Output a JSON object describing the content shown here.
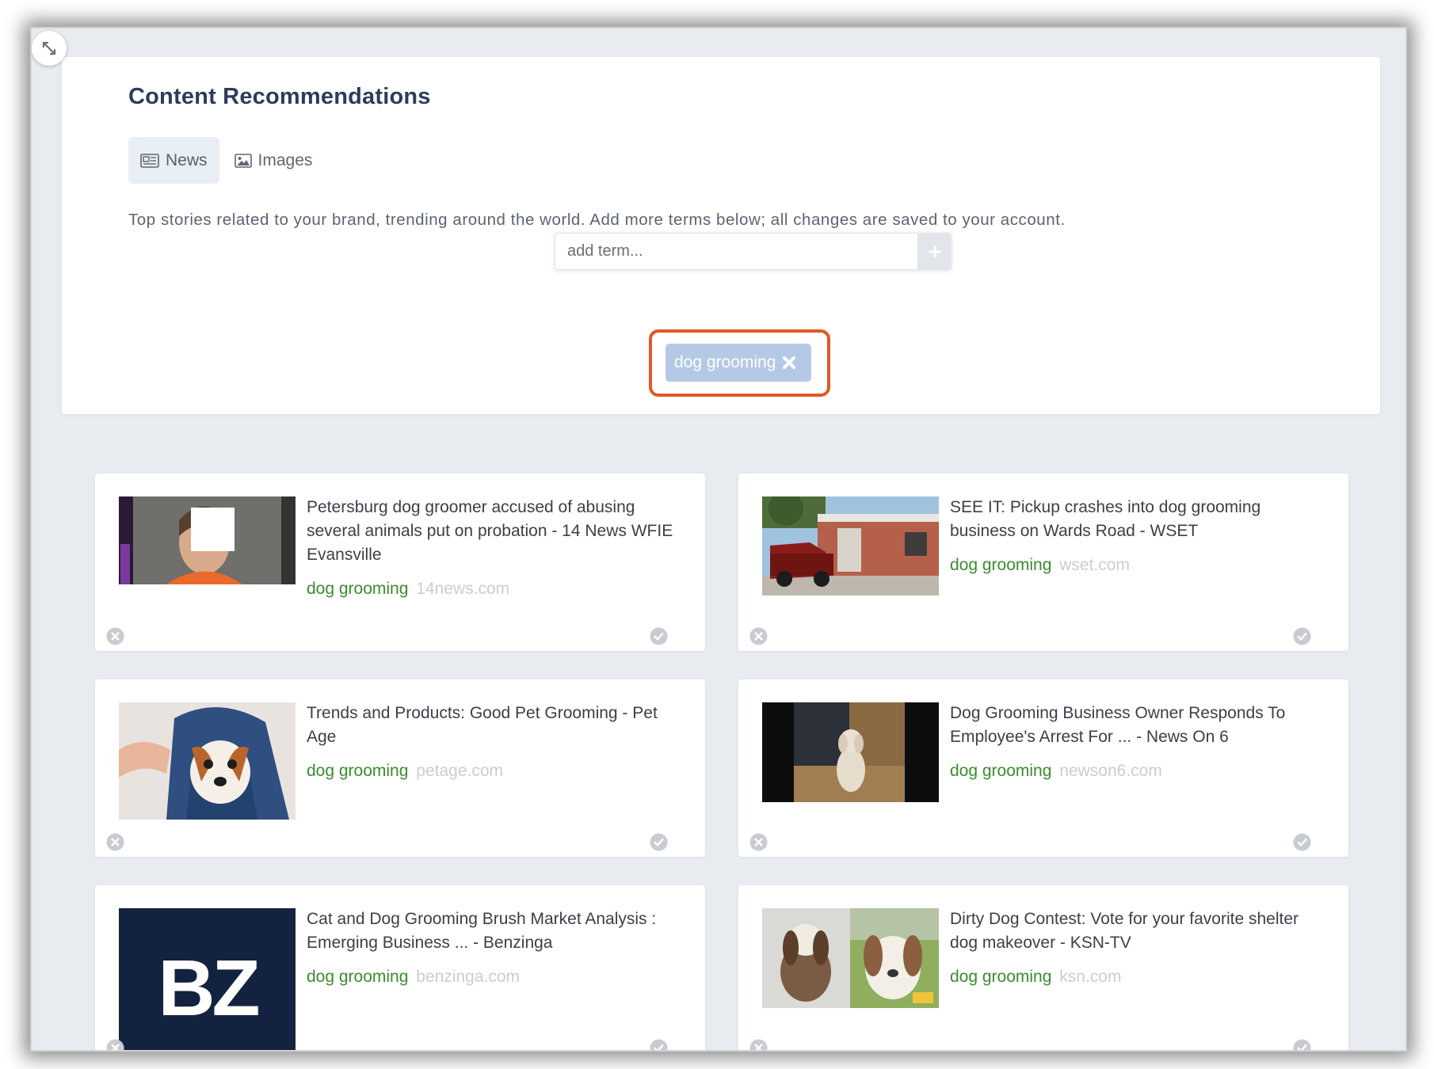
{
  "window": {
    "expand_icon": "expand-diagonal-icon"
  },
  "header": {
    "title": "Content Recommendations"
  },
  "tabs": [
    {
      "label": "News",
      "icon": "newspaper-icon",
      "active": true
    },
    {
      "label": "Images",
      "icon": "image-icon",
      "active": false
    }
  ],
  "description": "Top stories related to your brand, trending around the world. Add more terms below; all changes are saved to your account.",
  "term_input": {
    "placeholder": "add term...",
    "value": "",
    "add_icon": "plus-icon"
  },
  "terms": [
    {
      "label": "dog grooming",
      "remove_icon": "close-x-icon"
    }
  ],
  "colors": {
    "title": "#2b3d5b",
    "term_green": "#3a8c2e",
    "source_gray": "#c9cdd2",
    "chip_bg": "#b5c9e7",
    "highlight": "#dc5a27",
    "page_bg": "#e8ebef"
  },
  "cards": [
    {
      "title": "Petersburg dog groomer accused of abusing several animals put on probation - 14 News WFIE Evansville",
      "term": "dog grooming",
      "source": "14news.com"
    },
    {
      "title": "SEE IT: Pickup crashes into dog grooming business on Wards Road - WSET",
      "term": "dog grooming",
      "source": "wset.com"
    },
    {
      "title": "Trends and Products: Good Pet Grooming - Pet Age",
      "term": "dog grooming",
      "source": "petage.com"
    },
    {
      "title": "Dog Grooming Business Owner Responds To Employee's Arrest For ... - News On 6",
      "term": "dog grooming",
      "source": "newson6.com"
    },
    {
      "title": "Cat and Dog Grooming Brush Market Analysis : Emerging Business ... - Benzinga",
      "term": "dog grooming",
      "source": "benzinga.com",
      "logo_text": "BZ"
    },
    {
      "title": "Dirty Dog Contest: Vote for your favorite shelter dog makeover - KSN-TV",
      "term": "dog grooming",
      "source": "ksn.com"
    }
  ]
}
